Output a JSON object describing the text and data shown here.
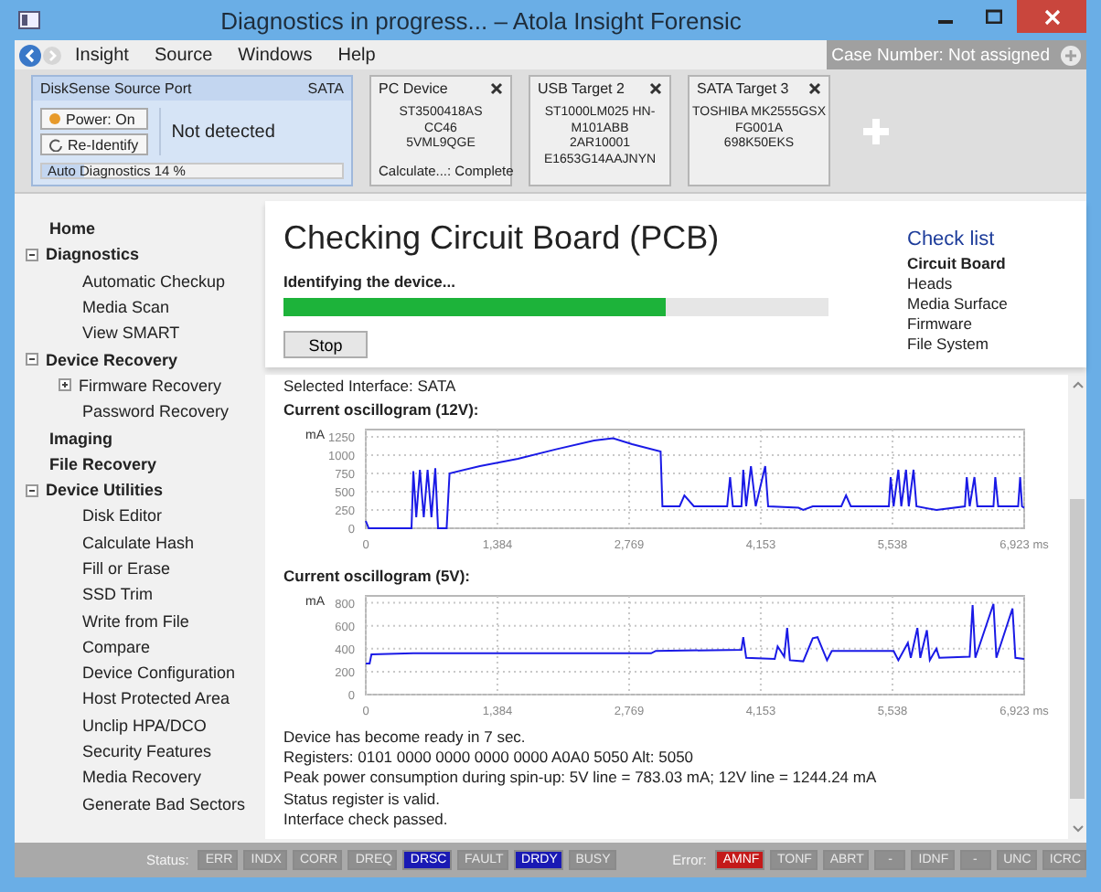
{
  "window": {
    "title": "Diagnostics in progress... – Atola Insight Forensic"
  },
  "menu": {
    "items": [
      "Insight",
      "Source",
      "Windows",
      "Help"
    ],
    "case_number": "Case Number: Not assigned"
  },
  "source_port": {
    "title": "DiskSense Source Port",
    "interface": "SATA",
    "buttons": [
      "Power: On",
      "Re-Identify"
    ],
    "status": "Not detected",
    "progress": {
      "label": "Auto Diagnostics 14 %",
      "level": 0.14
    }
  },
  "devices": [
    {
      "title": "PC Device",
      "lines": [
        "ST3500418AS",
        "CC46",
        "5VML9QGE"
      ],
      "footer": "Calculate...: Complete"
    },
    {
      "title": "USB Target 2",
      "lines": [
        "ST1000LM025 HN-",
        "M101ABB",
        "2AR10001",
        "E1653G14AAJNYN"
      ]
    },
    {
      "title": "SATA Target 3",
      "lines": [
        "TOSHIBA MK2555GSX",
        "FG001A",
        "698K50EKS"
      ]
    }
  ],
  "sidebar": {
    "items": [
      {
        "label": "Home"
      },
      {
        "label": "Diagnostics",
        "expanded": true,
        "children": [
          {
            "label": "Automatic Checkup"
          },
          {
            "label": "Media Scan"
          },
          {
            "label": "View SMART"
          }
        ]
      },
      {
        "label": "Device Recovery",
        "expanded": true,
        "children": [
          {
            "label": "Firmware Recovery",
            "expanded": false
          },
          {
            "label": "Password Recovery"
          }
        ]
      },
      {
        "label": "Imaging"
      },
      {
        "label": "File Recovery"
      },
      {
        "label": "Device Utilities",
        "expanded": true,
        "children": [
          {
            "label": "Disk Editor"
          },
          {
            "label": "Calculate Hash"
          },
          {
            "label": "Fill or Erase"
          },
          {
            "label": "SSD Trim"
          },
          {
            "label": "Write from File"
          },
          {
            "label": "Compare"
          },
          {
            "label": "Device Configuration"
          },
          {
            "label": "Host Protected Area"
          },
          {
            "label": "Unclip HPA/DCO"
          },
          {
            "label": "Security Features"
          },
          {
            "label": "Media Recovery"
          },
          {
            "label": "Generate Bad Sectors"
          }
        ]
      }
    ]
  },
  "main": {
    "heading": "Checking Circuit Board (PCB)",
    "step": "Identifying the device...",
    "progress": {
      "level": 0.7
    },
    "stop_button": "Stop",
    "check_list": {
      "title": "Check list",
      "items": [
        {
          "label": "Circuit Board",
          "selected": true
        },
        {
          "label": "Heads",
          "selected": false
        },
        {
          "label": "Media Surface",
          "selected": false
        },
        {
          "label": "Firmware",
          "selected": false
        },
        {
          "label": "File System",
          "selected": false
        }
      ]
    },
    "log": {
      "first_line": "Selected Interface: SATA",
      "oscillograms": [
        {
          "title": "Current oscillogram (12V):",
          "chart_data": {
            "type": "line",
            "ylabel": "mA",
            "xlim": [
              0,
              6923
            ],
            "ylim": [
              0,
              1350
            ],
            "xticks": [
              0,
              {
                "value": 1384,
                "label": "1,384"
              },
              {
                "value": 2769,
                "label": "2,769"
              },
              {
                "value": 4153,
                "label": "4,153"
              },
              {
                "value": 5538,
                "label": "5,538"
              },
              {
                "value": 6923,
                "label": "6,923 ms"
              }
            ],
            "yticks": [
              0,
              250,
              500,
              750,
              1000,
              1250
            ],
            "x": [
              0,
              30,
              480,
              500,
              530,
              570,
              610,
              650,
              690,
              730,
              760,
              850,
              880,
              1200,
              1600,
              2000,
              2400,
              2600,
              2800,
              3100,
              3120,
              3300,
              3350,
              3450,
              3800,
              3830,
              3860,
              3950,
              3970,
              4000,
              4050,
              4100,
              4200,
              4230,
              4550,
              4600,
              4700,
              5000,
              5050,
              5100,
              5500,
              5520,
              5550,
              5600,
              5630,
              5680,
              5710,
              5760,
              5790,
              6000,
              6300,
              6320,
              6350,
              6400,
              6430,
              6600,
              6620,
              6650,
              6860,
              6880,
              6900,
              6923
            ],
            "grid": true,
            "series": [
              {
                "color": "#1a1ae6",
                "values": [
                  100,
                  0,
                  0,
                  780,
                  150,
                  800,
                  150,
                  800,
                  150,
                  820,
                  0,
                  0,
                  750,
                  850,
                  950,
                  1080,
                  1200,
                  1230,
                  1150,
                  1050,
                  300,
                  300,
                  450,
                  300,
                  300,
                  700,
                  300,
                  300,
                  800,
                  300,
                  850,
                  300,
                  850,
                  300,
                  280,
                  250,
                  300,
                  300,
                  450,
                  300,
                  300,
                  700,
                  300,
                  800,
                  300,
                  800,
                  300,
                  800,
                  300,
                  250,
                  300,
                  700,
                  300,
                  700,
                  300,
                  300,
                  700,
                  300,
                  300,
                  700,
                  300,
                  280
                ]
              }
            ]
          }
        },
        {
          "title": "Current oscillogram (5V):",
          "chart_data": {
            "type": "line",
            "ylabel": "mA",
            "xlim": [
              0,
              6923
            ],
            "ylim": [
              0,
              860
            ],
            "xticks": [
              0,
              {
                "value": 1384,
                "label": "1,384"
              },
              {
                "value": 2769,
                "label": "2,769"
              },
              {
                "value": 4153,
                "label": "4,153"
              },
              {
                "value": 5538,
                "label": "5,538"
              },
              {
                "value": 6923,
                "label": "6,923 ms"
              }
            ],
            "yticks": [
              0,
              200,
              400,
              600,
              800
            ],
            "x": [
              0,
              40,
              60,
              500,
              3000,
              3050,
              3950,
              3970,
              4000,
              4300,
              4330,
              4400,
              4430,
              4460,
              4600,
              4700,
              4750,
              4850,
              4900,
              5550,
              5600,
              5700,
              5730,
              5800,
              5830,
              5900,
              5930,
              6000,
              6030,
              6350,
              6380,
              6410,
              6600,
              6630,
              6800,
              6830,
              6923
            ],
            "grid": true,
            "series": [
              {
                "color": "#1a1ae6",
                "values": [
                  270,
                  270,
                  350,
                  360,
                  360,
                  380,
                  390,
                  500,
                  320,
                  310,
                  420,
                  330,
                  580,
                  300,
                  290,
                  490,
                  500,
                  300,
                  380,
                  380,
                  300,
                  450,
                  320,
                  580,
                  320,
                  560,
                  300,
                  400,
                  320,
                  330,
                  780,
                  320,
                  790,
                  320,
                  750,
                  320,
                  310
                ]
              }
            ]
          }
        }
      ],
      "lines": [
        "Device has become ready in 7 sec.",
        "Registers: 0101 0000 0000 0000 0000 A0A0 5050  Alt: 5050",
        "Peak power consumption during spin-up: 5V line = 783.03 mA; 12V line = 1244.24 mA",
        "Status register is valid.",
        "Interface check passed."
      ]
    }
  },
  "status_bar": {
    "groups": [
      {
        "kind": "status",
        "label": "Status:",
        "flags": [
          {
            "text": "ERR",
            "on": false
          },
          {
            "text": "INDX",
            "on": false
          },
          {
            "text": "CORR",
            "on": false
          },
          {
            "text": "DREQ",
            "on": false
          },
          {
            "text": "DRSC",
            "on": true
          },
          {
            "text": "FAULT",
            "on": false
          },
          {
            "text": "DRDY",
            "on": true
          },
          {
            "text": "BUSY",
            "on": false
          }
        ]
      },
      {
        "kind": "error",
        "label": "Error:",
        "flags": [
          {
            "text": "AMNF",
            "on": true
          },
          {
            "text": "TONF",
            "on": false
          },
          {
            "text": "ABRT",
            "on": false
          },
          {
            "text": "-",
            "on": false
          },
          {
            "text": "IDNF",
            "on": false
          },
          {
            "text": "-",
            "on": false
          },
          {
            "text": "UNC",
            "on": false
          },
          {
            "text": "ICRC",
            "on": false
          }
        ]
      }
    ]
  }
}
